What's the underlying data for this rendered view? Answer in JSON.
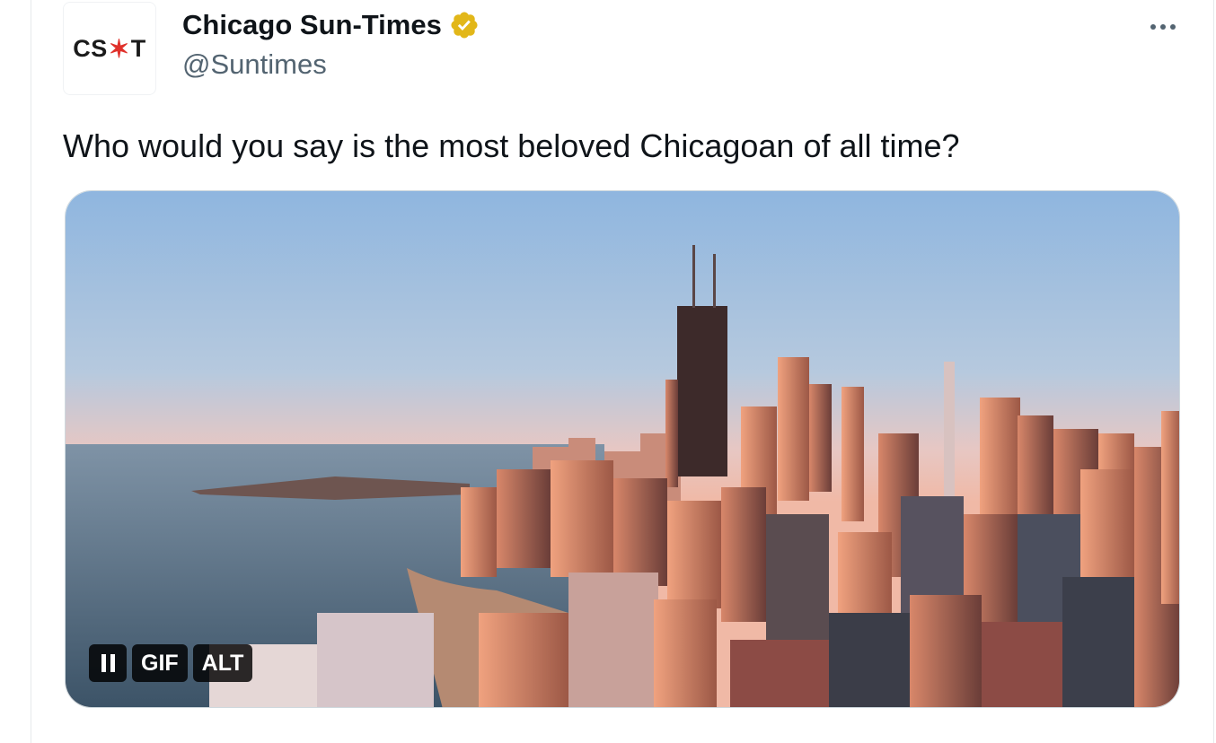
{
  "account": {
    "avatar_text_left": "CS",
    "avatar_star": "✶",
    "avatar_text_right": "T",
    "display_name": "Chicago Sun-Times",
    "handle": "@Suntimes",
    "verified_badge_color": "#e2b719"
  },
  "tweet": {
    "text": "Who would you say is the most beloved Chicagoan of all time?"
  },
  "media": {
    "type": "gif",
    "subject": "aerial-city-skyline",
    "controls": {
      "pause_icon": "pause-icon",
      "gif_label": "GIF",
      "alt_label": "ALT"
    }
  },
  "menu": {
    "more_icon": "more-options-icon"
  },
  "colors": {
    "text_primary": "#0f1419",
    "text_secondary": "#536471",
    "border": "#cfd9de"
  }
}
